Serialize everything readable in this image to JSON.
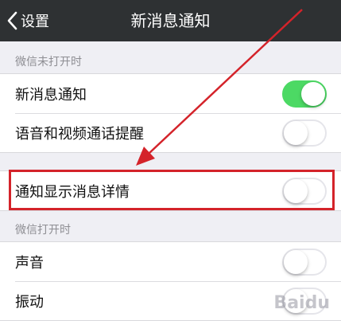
{
  "navbar": {
    "back_label": "设置",
    "title": "新消息通知"
  },
  "sections": [
    {
      "header": "微信未打开时",
      "rows": [
        {
          "label": "新消息通知",
          "toggle": true
        },
        {
          "label": "语音和视频通话提醒",
          "toggle": false
        }
      ]
    },
    {
      "header": "",
      "rows": [
        {
          "label": "通知显示消息详情",
          "toggle": false
        }
      ]
    },
    {
      "header": "微信打开时",
      "rows": [
        {
          "label": "声音",
          "toggle": false
        },
        {
          "label": "振动",
          "toggle": false
        }
      ]
    }
  ],
  "annotation": {
    "highlight_color": "#d4232a",
    "arrow_color": "#d4232a"
  },
  "watermark": "Baidu",
  "colors": {
    "navbar_bg": "#2e3133",
    "toggle_on": "#4cd964",
    "page_bg": "#efeff4"
  }
}
